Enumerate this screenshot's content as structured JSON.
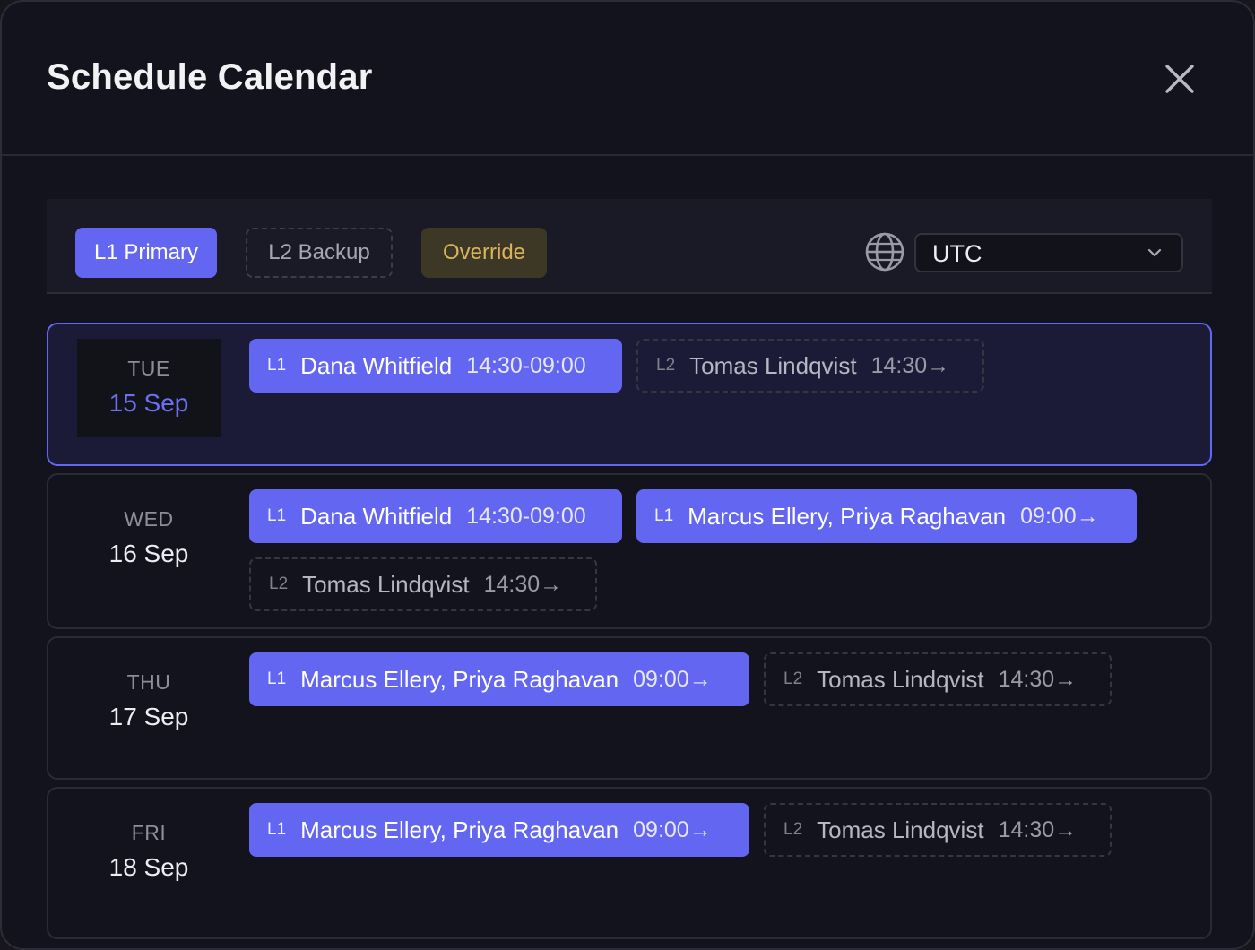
{
  "header": {
    "title": "Schedule Calendar"
  },
  "filters": {
    "primary_label": "L1 Primary",
    "backup_label": "L2 Backup",
    "override_label": "Override"
  },
  "timezone": {
    "value": "UTC"
  },
  "colors": {
    "accent": "#6366f1",
    "override": "#d8b45c",
    "background": "#13131d"
  },
  "days": [
    {
      "dow": "TUE",
      "date": "15 Sep",
      "selected": true,
      "shifts": [
        {
          "level": "L1",
          "who": "Dana Whitfield",
          "when": "14:30-09:00"
        },
        {
          "level": "L2",
          "who": "Tomas Lindqvist",
          "when": "14:30→"
        }
      ]
    },
    {
      "dow": "WED",
      "date": "16 Sep",
      "selected": false,
      "shifts": [
        {
          "level": "L1",
          "who": "Dana Whitfield",
          "when": "14:30-09:00"
        },
        {
          "level": "L1",
          "who": "Marcus Ellery, Priya Raghavan",
          "when": "09:00→"
        },
        {
          "level": "L2",
          "who": "Tomas Lindqvist",
          "when": "14:30→"
        }
      ]
    },
    {
      "dow": "THU",
      "date": "17 Sep",
      "selected": false,
      "shifts": [
        {
          "level": "L1",
          "who": "Marcus Ellery, Priya Raghavan",
          "when": "09:00→"
        },
        {
          "level": "L2",
          "who": "Tomas Lindqvist",
          "when": "14:30→"
        }
      ]
    },
    {
      "dow": "FRI",
      "date": "18 Sep",
      "selected": false,
      "shifts": [
        {
          "level": "L1",
          "who": "Marcus Ellery, Priya Raghavan",
          "when": "09:00→"
        },
        {
          "level": "L2",
          "who": "Tomas Lindqvist",
          "when": "14:30→"
        }
      ]
    }
  ]
}
